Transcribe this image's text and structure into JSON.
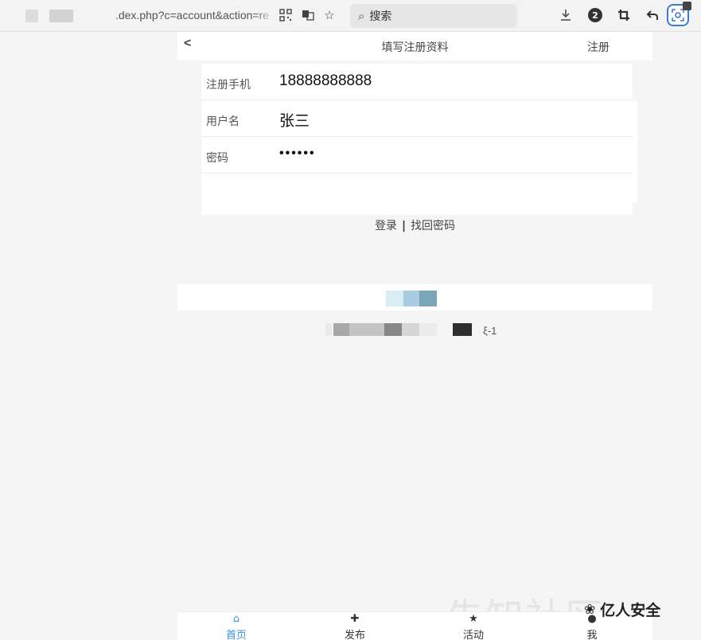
{
  "browser": {
    "url_text": ".dex.php?c=account&action=re",
    "search_glyph": "⌕",
    "search_placeholder": "搜索",
    "badge_count": "2",
    "icons": [
      "qr-icon",
      "translate-icon",
      "star-icon",
      "download-icon",
      "crop-icon",
      "undo-icon",
      "lens-icon"
    ]
  },
  "nav": {
    "back": "<",
    "title": "填写注册资料",
    "action": "注册"
  },
  "form": {
    "rows": [
      {
        "label": "注册手机",
        "value": "18888888888"
      },
      {
        "label": "用户名",
        "value": "张三"
      },
      {
        "label": "密码",
        "value": "••••••"
      }
    ]
  },
  "links": {
    "login": "登录",
    "separator": "|",
    "recover": "找回密码"
  },
  "footer": {
    "suffix": "ξ-1"
  },
  "tabbar": {
    "items": [
      {
        "icon": "home-icon",
        "glyph": "⌂",
        "label": "首页",
        "active": true
      },
      {
        "icon": "plus-icon",
        "glyph": "✚",
        "label": "发布",
        "active": false
      },
      {
        "icon": "star-icon",
        "glyph": "★",
        "label": "活动",
        "active": false
      },
      {
        "icon": "user-icon",
        "glyph": "●",
        "label": "我",
        "active": false
      }
    ]
  },
  "watermark": {
    "ghost": "先知社区",
    "chat_glyph": "❀",
    "text": "亿人安全"
  },
  "colors": {
    "accent": "#3a8ee6",
    "background": "#f5f5f5"
  }
}
